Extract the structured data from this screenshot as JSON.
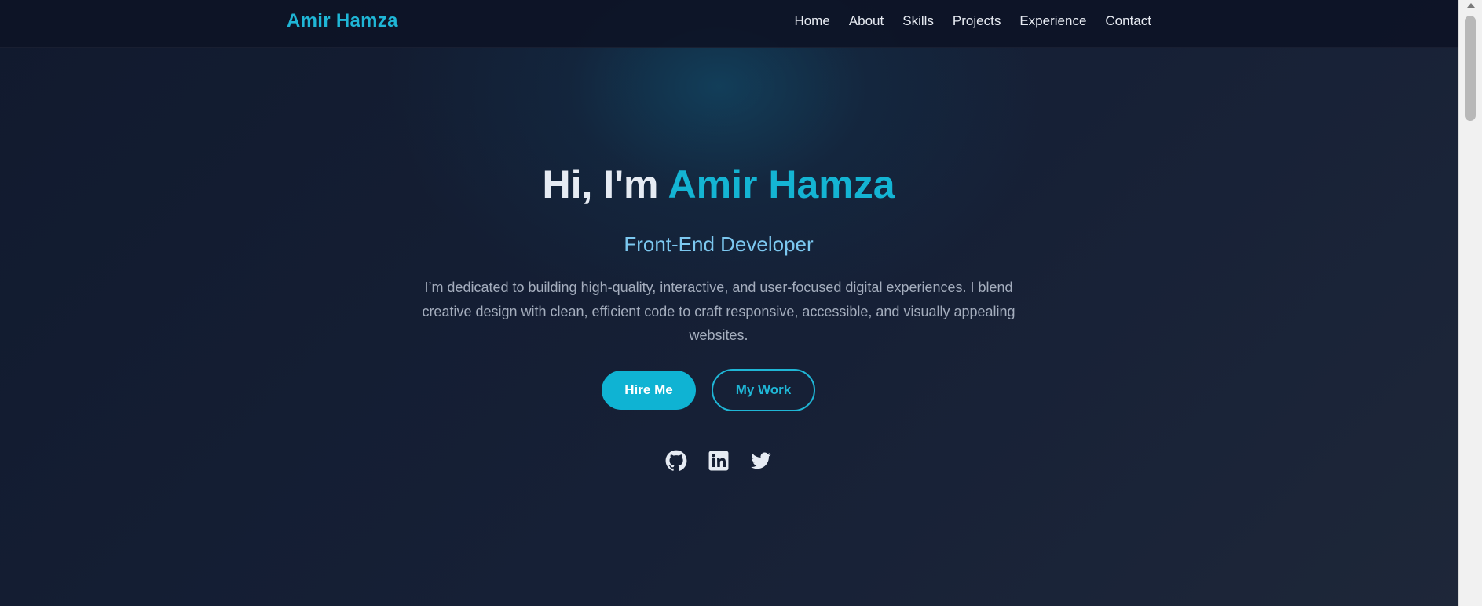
{
  "navbar": {
    "brand": "Amir Hamza",
    "links": [
      "Home",
      "About",
      "Skills",
      "Projects",
      "Experience",
      "Contact"
    ]
  },
  "hero": {
    "title_prefix": "Hi, I'm ",
    "title_name": "Amir Hamza",
    "subtitle": "Front-End Developer",
    "description": "I’m dedicated to building high-quality, interactive, and user-focused digital experiences. I blend creative design with clean, efficient code to craft responsive, accessible, and visually appealing websites.",
    "primary_button": "Hire Me",
    "secondary_button": "My Work",
    "socials": [
      "github-icon",
      "linkedin-icon",
      "twitter-icon"
    ]
  },
  "colors": {
    "accent": "#14b4d3",
    "background": "#151e33",
    "subtitle": "#7cc8f0",
    "text_muted": "#a4adbd"
  }
}
